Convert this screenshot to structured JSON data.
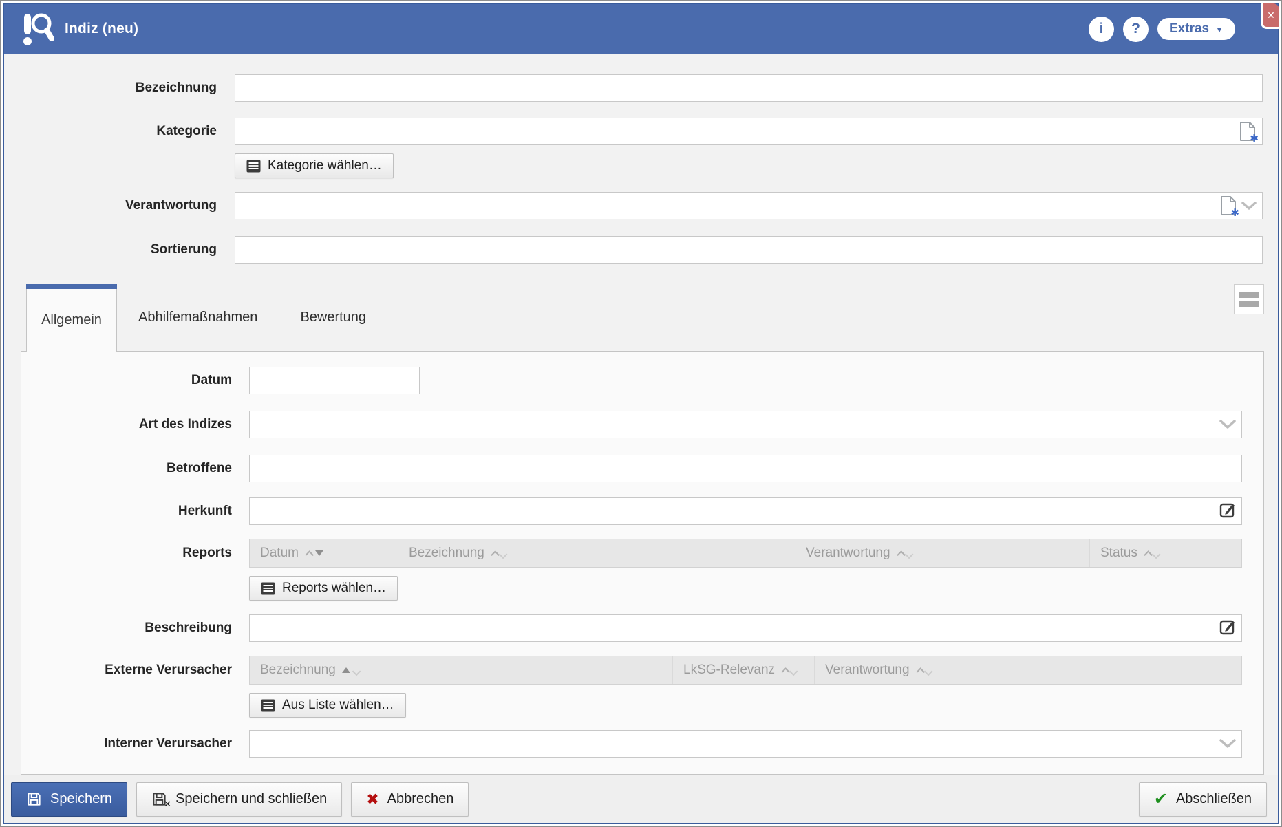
{
  "window": {
    "title": "Indiz (neu)"
  },
  "header": {
    "info_glyph": "i",
    "help_glyph": "?",
    "extras_label": "Extras",
    "extras_caret": "▼",
    "close_glyph": "✕"
  },
  "form": {
    "bezeichnung_label": "Bezeichnung",
    "kategorie_label": "Kategorie",
    "kategorie_button": "Kategorie wählen…",
    "verantwortung_label": "Verantwortung",
    "sortierung_label": "Sortierung"
  },
  "tabs": {
    "items": [
      {
        "label": "Allgemein",
        "active": true
      },
      {
        "label": "Abhilfemaßnahmen",
        "active": false
      },
      {
        "label": "Bewertung",
        "active": false
      }
    ]
  },
  "panel": {
    "datum_label": "Datum",
    "art_label": "Art des Indizes",
    "betroffene_label": "Betroffene",
    "herkunft_label": "Herkunft",
    "reports_label": "Reports",
    "reports_button": "Reports wählen…",
    "reports_columns": [
      {
        "label": "Datum",
        "sort": "desc"
      },
      {
        "label": "Bezeichnung",
        "sort": "none"
      },
      {
        "label": "Verantwortung",
        "sort": "none"
      },
      {
        "label": "Status",
        "sort": "none"
      }
    ],
    "beschreibung_label": "Beschreibung",
    "externe_label": "Externe Verursacher",
    "externe_button": "Aus Liste wählen…",
    "externe_columns": [
      {
        "label": "Bezeichnung",
        "sort": "asc"
      },
      {
        "label": "LkSG-Relevanz",
        "sort": "none"
      },
      {
        "label": "Verantwortung",
        "sort": "none"
      }
    ],
    "interner_label": "Interner Verursacher"
  },
  "icons": {
    "doc_new_star": "✱",
    "cancel_x": "✖",
    "confirm_check": "✔",
    "save_close_x": "✕"
  },
  "footer": {
    "save_label": "Speichern",
    "save_close_label": "Speichern und schließen",
    "cancel_label": "Abbrechen",
    "finish_label": "Abschließen"
  },
  "colors": {
    "header_blue": "#4a6bad",
    "primary_button_blue": "#3e63a9",
    "close_red": "#c96b6b",
    "check_green": "#1f8f1f",
    "cancel_red": "#b40f0f",
    "doc_star_blue": "#3a67c8"
  }
}
